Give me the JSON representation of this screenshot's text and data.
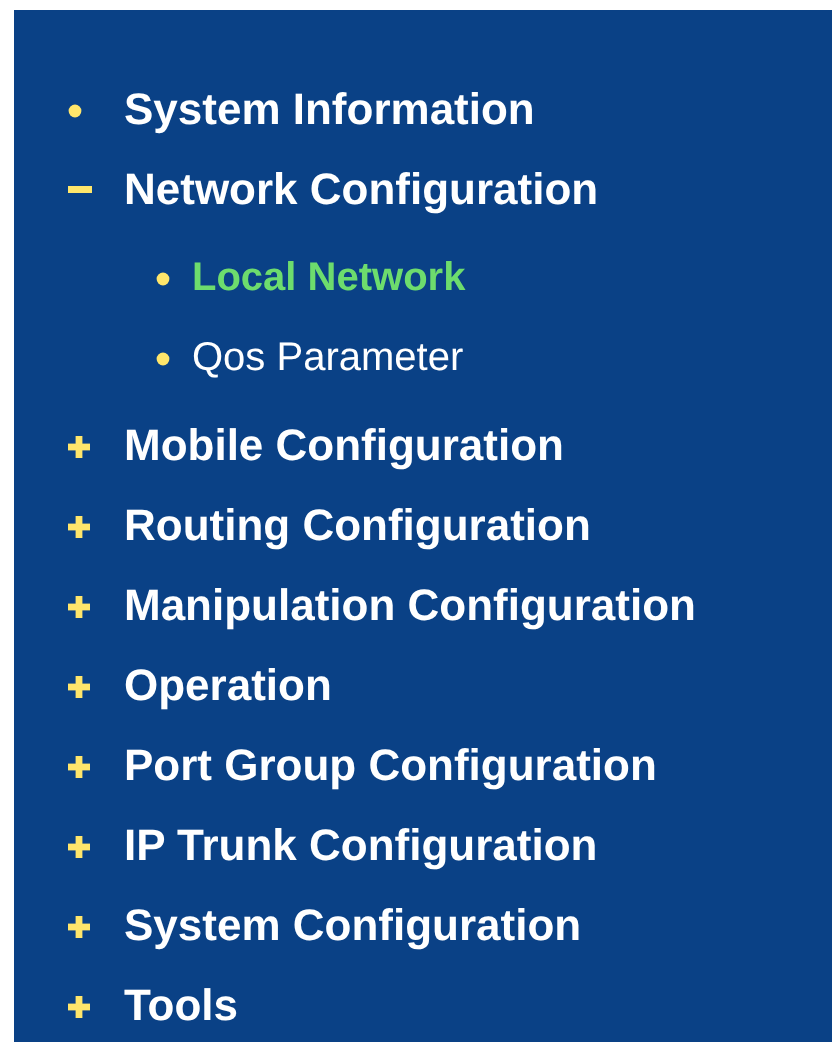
{
  "menu": {
    "items": [
      {
        "label": "System Information",
        "kind": "leaf",
        "selected": false
      },
      {
        "label": "Network Configuration",
        "kind": "folder",
        "expanded": true,
        "selected": false,
        "children": [
          {
            "label": "Local Network",
            "kind": "leaf",
            "selected": true
          },
          {
            "label": "Qos Parameter",
            "kind": "leaf",
            "selected": false
          }
        ]
      },
      {
        "label": "Mobile Configuration",
        "kind": "folder",
        "expanded": false,
        "selected": false
      },
      {
        "label": "Routing Configuration",
        "kind": "folder",
        "expanded": false,
        "selected": false
      },
      {
        "label": "Manipulation Configuration",
        "kind": "folder",
        "expanded": false,
        "selected": false
      },
      {
        "label": "Operation",
        "kind": "folder",
        "expanded": false,
        "selected": false
      },
      {
        "label": "Port Group Configuration",
        "kind": "folder",
        "expanded": false,
        "selected": false
      },
      {
        "label": "IP Trunk Configuration",
        "kind": "folder",
        "expanded": false,
        "selected": false
      },
      {
        "label": "System Configuration",
        "kind": "folder",
        "expanded": false,
        "selected": false
      },
      {
        "label": "Tools",
        "kind": "folder",
        "expanded": false,
        "selected": false
      }
    ]
  }
}
